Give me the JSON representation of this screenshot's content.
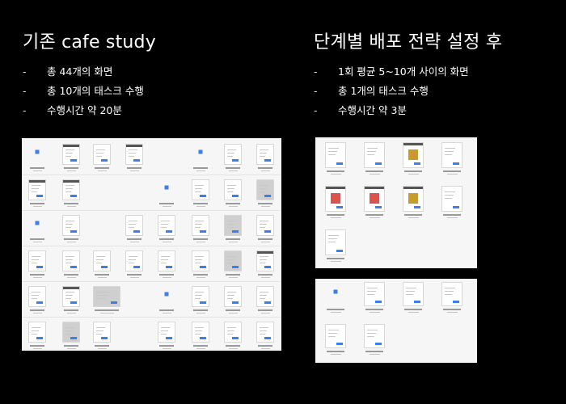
{
  "left": {
    "title": "기존 cafe study",
    "bullets": [
      {
        "dash": "-",
        "text": "총 44개의 화면"
      },
      {
        "dash": "-",
        "text": "총 10개의 태스크 수행"
      },
      {
        "dash": "-",
        "text": "수행시간 약 20분"
      }
    ]
  },
  "right": {
    "title": "단계별 배포 전략 설정 후",
    "bullets": [
      {
        "dash": "-",
        "text": "1회 평균 5~10개 사이의 화면"
      },
      {
        "dash": "-",
        "text": "총 1개의 태스크 수행"
      },
      {
        "dash": "-",
        "text": "수행시간 약 3분"
      }
    ]
  },
  "colors": {
    "background": "#000000",
    "panel": "#f6f6f6",
    "accent_blue": "#3d7fe6"
  }
}
